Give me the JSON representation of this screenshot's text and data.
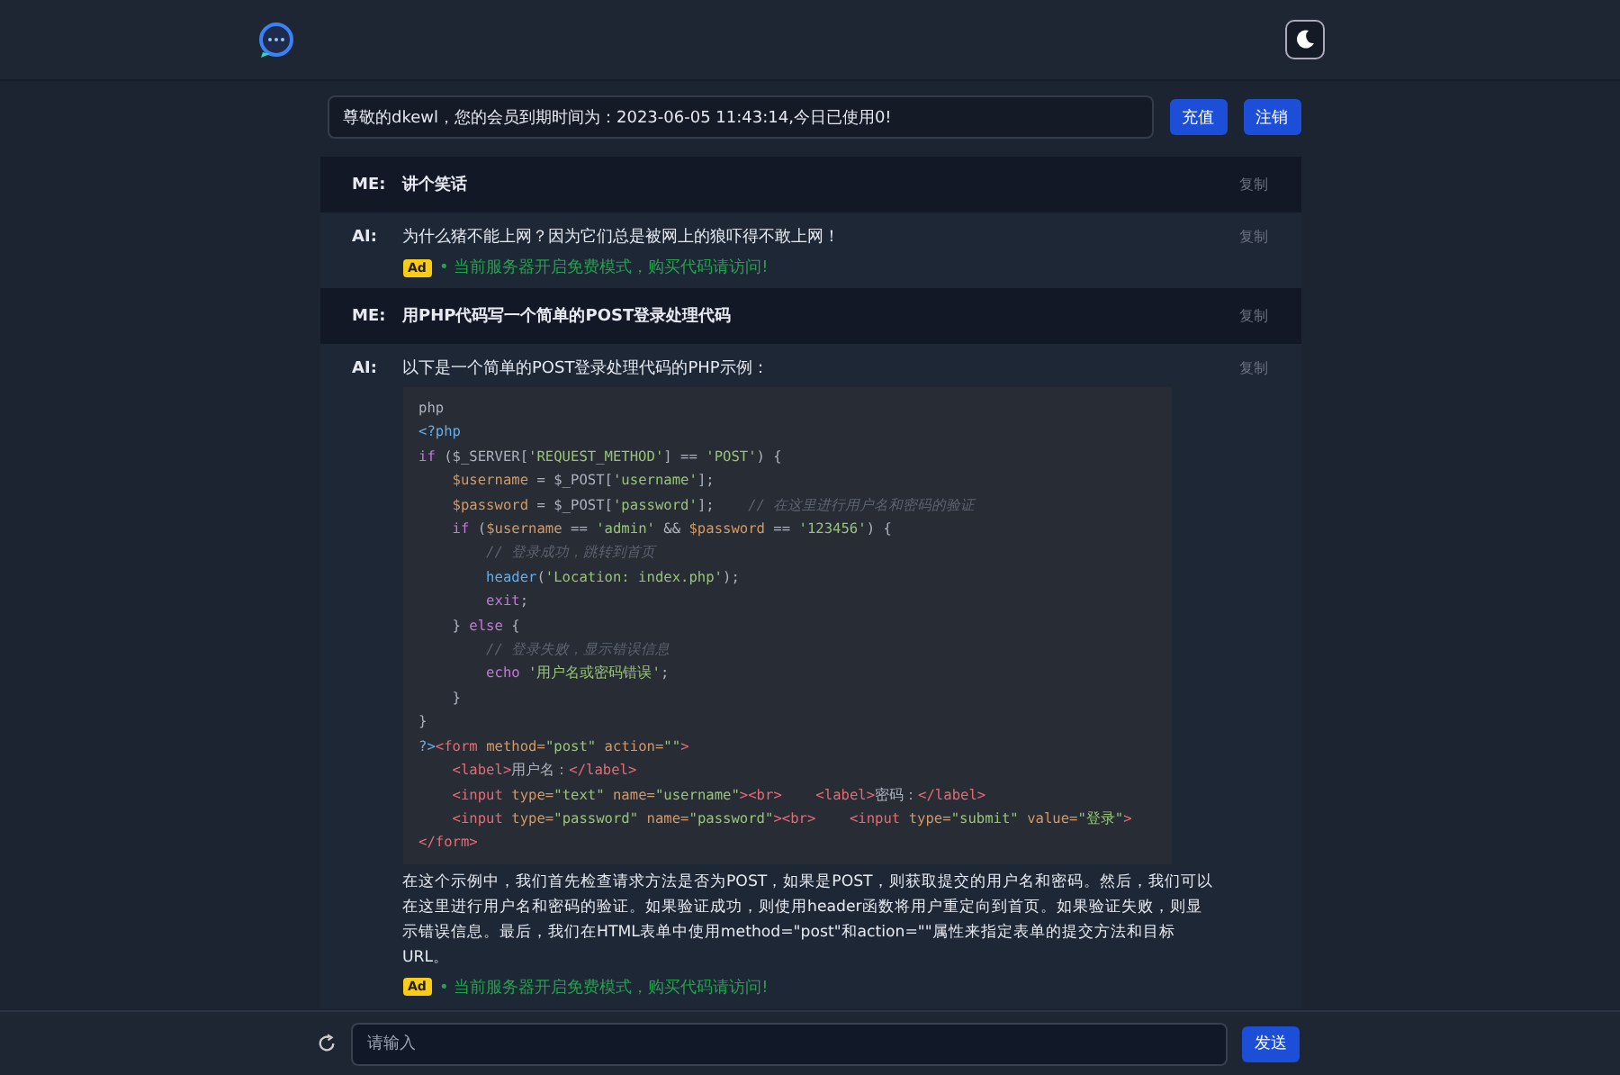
{
  "notice": {
    "text": "尊敬的dkewl，您的会员到期时间为：2023-06-05 11:43:14,今日已使用0!",
    "buttons": [
      "充值",
      "注销"
    ]
  },
  "messages": [
    {
      "role": "ME:",
      "kind": "user",
      "text": "讲个笑话",
      "copy": "复制"
    },
    {
      "role": "AI:",
      "kind": "bot",
      "text": "为什么猪不能上网？因为它们总是被网上的狼吓得不敢上网！",
      "copy": "复制",
      "ad": {
        "badge": "Ad",
        "bullet": "•",
        "text": "当前服务器开启免费模式，购买代码请访问!"
      }
    },
    {
      "role": "ME:",
      "kind": "user",
      "text": "用PHP代码写一个简单的POST登录处理代码",
      "copy": "复制"
    },
    {
      "role": "AI:",
      "kind": "bot",
      "text": "以下是一个简单的POST登录处理代码的PHP示例：",
      "copy": "复制",
      "code": [
        [
          {
            "kind": "plain",
            "text": "php"
          }
        ],
        [
          {
            "kind": "meta",
            "text": "<?php"
          }
        ],
        [
          {
            "kind": "kw",
            "text": "if"
          },
          {
            "kind": "plain",
            "text": " ($_SERVER["
          },
          {
            "kind": "str",
            "text": "'REQUEST_METHOD'"
          },
          {
            "kind": "plain",
            "text": "] == "
          },
          {
            "kind": "str",
            "text": "'POST'"
          },
          {
            "kind": "plain",
            "text": ") {"
          }
        ],
        [
          {
            "kind": "var",
            "text": "    $username"
          },
          {
            "kind": "plain",
            "text": " = $_POST["
          },
          {
            "kind": "str",
            "text": "'username'"
          },
          {
            "kind": "plain",
            "text": "];"
          }
        ],
        [
          {
            "kind": "var",
            "text": "    $password"
          },
          {
            "kind": "plain",
            "text": " = $_POST["
          },
          {
            "kind": "str",
            "text": "'password'"
          },
          {
            "kind": "plain",
            "text": "];    "
          },
          {
            "kind": "comment",
            "text": "// 在这里进行用户名和密码的验证"
          }
        ],
        [
          {
            "kind": "kw",
            "text": "    if"
          },
          {
            "kind": "plain",
            "text": " ("
          },
          {
            "kind": "var",
            "text": "$username"
          },
          {
            "kind": "plain",
            "text": " == "
          },
          {
            "kind": "str",
            "text": "'admin'"
          },
          {
            "kind": "plain",
            "text": " && "
          },
          {
            "kind": "var",
            "text": "$password"
          },
          {
            "kind": "plain",
            "text": " == "
          },
          {
            "kind": "str",
            "text": "'123456'"
          },
          {
            "kind": "plain",
            "text": ") {"
          }
        ],
        [
          {
            "kind": "comment",
            "text": "        // 登录成功，跳转到首页"
          }
        ],
        [
          {
            "kind": "func",
            "text": "        header"
          },
          {
            "kind": "plain",
            "text": "("
          },
          {
            "kind": "str",
            "text": "'Location: index.php'"
          },
          {
            "kind": "plain",
            "text": ");"
          }
        ],
        [
          {
            "kind": "kw",
            "text": "        exit"
          },
          {
            "kind": "plain",
            "text": ";"
          }
        ],
        [
          {
            "kind": "plain",
            "text": "    } "
          },
          {
            "kind": "kw",
            "text": "else"
          },
          {
            "kind": "plain",
            "text": " {"
          }
        ],
        [
          {
            "kind": "comment",
            "text": "        // 登录失败，显示错误信息"
          }
        ],
        [
          {
            "kind": "kw",
            "text": "        echo"
          },
          {
            "kind": "str",
            "text": " '用户名或密码错误'"
          },
          {
            "kind": "plain",
            "text": ";"
          }
        ],
        [
          {
            "kind": "plain",
            "text": "    }"
          }
        ],
        [
          {
            "kind": "plain",
            "text": "}"
          }
        ],
        [
          {
            "kind": "meta",
            "text": "?>"
          },
          {
            "kind": "tag",
            "text": "<form"
          },
          {
            "kind": "attr",
            "text": " method="
          },
          {
            "kind": "str",
            "text": "\"post\""
          },
          {
            "kind": "attr",
            "text": " action="
          },
          {
            "kind": "str",
            "text": "\"\""
          },
          {
            "kind": "tag",
            "text": ">"
          }
        ],
        [
          {
            "kind": "tag",
            "text": "    <label>"
          },
          {
            "kind": "plain",
            "text": "用户名："
          },
          {
            "kind": "tag",
            "text": "</label>"
          }
        ],
        [
          {
            "kind": "tag",
            "text": "    <input"
          },
          {
            "kind": "attr",
            "text": " type="
          },
          {
            "kind": "str",
            "text": "\"text\""
          },
          {
            "kind": "attr",
            "text": " name="
          },
          {
            "kind": "str",
            "text": "\"username\""
          },
          {
            "kind": "tag",
            "text": "><br>"
          },
          {
            "kind": "tag",
            "text": "    <label>"
          },
          {
            "kind": "plain",
            "text": "密码："
          },
          {
            "kind": "tag",
            "text": "</label>"
          }
        ],
        [
          {
            "kind": "tag",
            "text": "    <input"
          },
          {
            "kind": "attr",
            "text": " type="
          },
          {
            "kind": "str",
            "text": "\"password\""
          },
          {
            "kind": "attr",
            "text": " name="
          },
          {
            "kind": "str",
            "text": "\"password\""
          },
          {
            "kind": "tag",
            "text": "><br>"
          },
          {
            "kind": "tag",
            "text": "    <input"
          },
          {
            "kind": "attr",
            "text": " type="
          },
          {
            "kind": "str",
            "text": "\"submit\""
          },
          {
            "kind": "attr",
            "text": " value="
          },
          {
            "kind": "str",
            "text": "\"登录\""
          },
          {
            "kind": "tag",
            "text": ">"
          }
        ],
        [
          {
            "kind": "tag",
            "text": "</form>"
          }
        ]
      ],
      "after": "在这个示例中，我们首先检查请求方法是否为POST，如果是POST，则获取提交的用户名和密码。然后，我们可以在这里进行用户名和密码的验证。如果验证成功，则使用header函数将用户重定向到首页。如果验证失败，则显示错误信息。最后，我们在HTML表单中使用method=\"post\"和action=\"\"属性来指定表单的提交方法和目标URL。",
      "ad": {
        "badge": "Ad",
        "bullet": "•",
        "text": "当前服务器开启免费模式，购买代码请访问!"
      }
    }
  ],
  "composer": {
    "placeholder": "请输入",
    "send": "发送"
  }
}
